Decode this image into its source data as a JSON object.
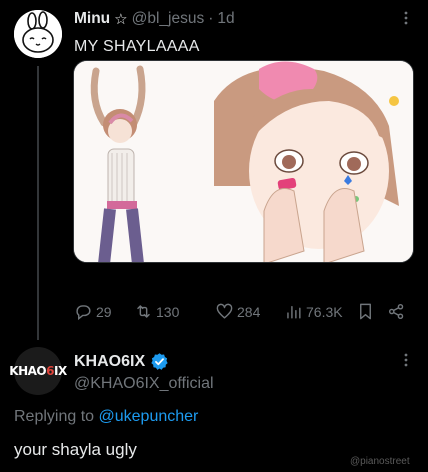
{
  "tweet": {
    "author_name": "Minu",
    "author_badge": "☆",
    "handle": "@bl_jesus",
    "separator": "·",
    "timestamp": "1d",
    "text": "MY SHAYLAAAA",
    "stats": {
      "replies": "29",
      "retweets": "130",
      "likes": "284",
      "views": "76.3K"
    }
  },
  "reply": {
    "avatar_text_a": "KHAO",
    "avatar_text_b": "6",
    "avatar_text_c": "IX",
    "author_name": "KHAO6IX",
    "handle": "@KHAO6IX_official",
    "replying_prefix": "Replying to",
    "replying_to": "@ukepuncher",
    "text": "your shayla ugly"
  },
  "watermark": "@pianostreet",
  "colors": {
    "background": "#000000",
    "text": "#e7e9ea",
    "muted": "#71767b",
    "link": "#1d9bf0",
    "verified": "#1d9bf0"
  },
  "icons": {
    "more": "more-dots-icon",
    "reply": "reply-icon",
    "retweet": "retweet-icon",
    "like": "heart-icon",
    "views": "views-icon",
    "bookmark": "bookmark-icon",
    "share": "share-icon",
    "verified": "verified-badge-icon"
  }
}
